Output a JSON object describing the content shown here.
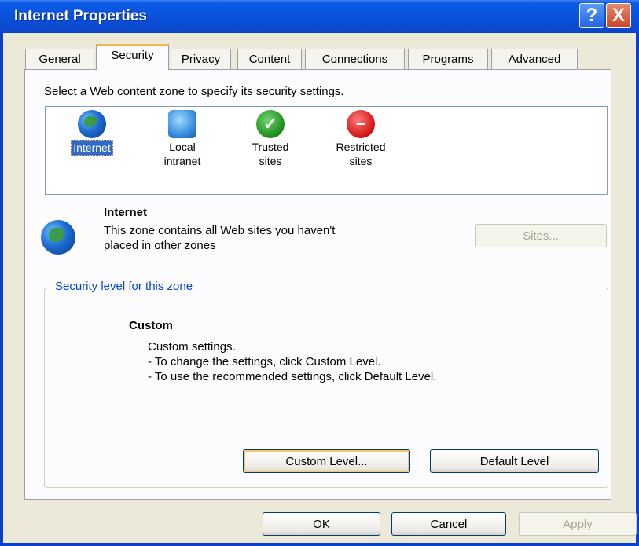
{
  "window": {
    "title": "Internet Properties",
    "help_label": "?",
    "close_label": "X"
  },
  "tabs": [
    "General",
    "Security",
    "Privacy",
    "Content",
    "Connections",
    "Programs",
    "Advanced"
  ],
  "security": {
    "instruction": "Select a Web content zone to specify its security settings.",
    "zones": [
      {
        "label": "Internet",
        "icon": "globe-icon",
        "selected": true
      },
      {
        "label": "Local\nintranet",
        "icon": "local-intranet-icon"
      },
      {
        "label": "Trusted\nsites",
        "icon": "trusted-check-icon"
      },
      {
        "label": "Restricted\nsites",
        "icon": "restricted-icon"
      }
    ],
    "zone_name": "Internet",
    "zone_description": "This zone contains all Web sites you haven't placed in other zones",
    "sites_button": "Sites...",
    "group_title": "Security level for this zone",
    "level_name": "Custom",
    "level_text": "Custom settings.\n- To change the settings, click Custom Level.\n- To use the recommended settings, click Default Level.",
    "custom_level_button": "Custom Level...",
    "default_level_button": "Default Level"
  },
  "footer": {
    "ok": "OK",
    "cancel": "Cancel",
    "apply": "Apply"
  }
}
